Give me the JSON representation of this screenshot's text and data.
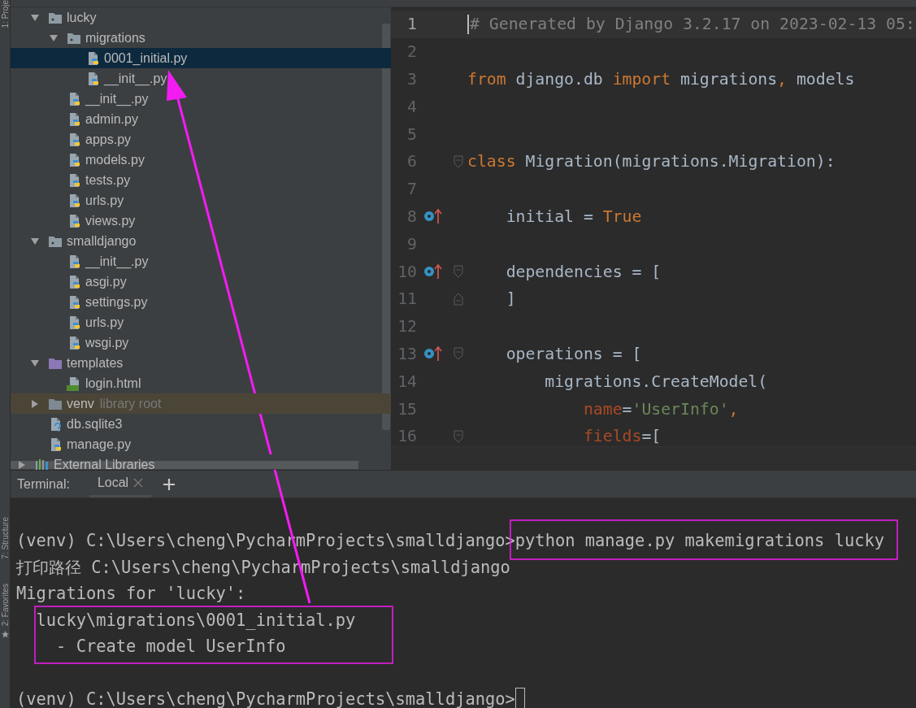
{
  "tool_strip": [
    "1: Proje",
    "7: Structure",
    "2: Favorites"
  ],
  "tree": [
    {
      "label": "lucky",
      "kind": "package",
      "expanded": true,
      "selected": false,
      "children": [
        {
          "label": "migrations",
          "kind": "package",
          "expanded": true,
          "selected": false,
          "children": [
            {
              "label": "0001_initial.py",
              "kind": "python",
              "selected": true
            },
            {
              "label": "__init__.py",
              "kind": "python",
              "selected": false
            }
          ]
        },
        {
          "label": "__init__.py",
          "kind": "python",
          "selected": false
        },
        {
          "label": "admin.py",
          "kind": "python",
          "selected": false
        },
        {
          "label": "apps.py",
          "kind": "python",
          "selected": false
        },
        {
          "label": "models.py",
          "kind": "python",
          "selected": false
        },
        {
          "label": "tests.py",
          "kind": "python",
          "selected": false
        },
        {
          "label": "urls.py",
          "kind": "python",
          "selected": false
        },
        {
          "label": "views.py",
          "kind": "python",
          "selected": false
        }
      ]
    },
    {
      "label": "smalldjango",
      "kind": "package",
      "expanded": true,
      "selected": false,
      "children": [
        {
          "label": "__init__.py",
          "kind": "python",
          "selected": false
        },
        {
          "label": "asgi.py",
          "kind": "python",
          "selected": false
        },
        {
          "label": "settings.py",
          "kind": "python",
          "selected": false
        },
        {
          "label": "urls.py",
          "kind": "python",
          "selected": false
        },
        {
          "label": "wsgi.py",
          "kind": "python",
          "selected": false
        }
      ]
    },
    {
      "label": "templates",
      "kind": "templates-folder",
      "expanded": true,
      "selected": false,
      "children": [
        {
          "label": "login.html",
          "kind": "html",
          "selected": false
        }
      ]
    },
    {
      "label": "venv",
      "kind": "excluded-folder",
      "expanded": false,
      "selected": false,
      "hint": "library root"
    },
    {
      "label": "db.sqlite3",
      "kind": "unknown",
      "selected": false
    },
    {
      "label": "manage.py",
      "kind": "python",
      "selected": false
    },
    {
      "label": "External Libraries",
      "kind": "libraries",
      "expanded": false,
      "selected": false
    }
  ],
  "editor": {
    "lines": [
      {
        "number": "1",
        "current": true,
        "tokens": [
          {
            "text": "# Generated by Django 3.2.17 on 2023-02-13 05:",
            "kind": "comment"
          }
        ]
      },
      {
        "number": "2",
        "current": false
      },
      {
        "number": "3",
        "current": false,
        "tokens": [
          {
            "text": "from ",
            "kind": "keyword"
          },
          {
            "text": "django.db ",
            "kind": "plain"
          },
          {
            "text": "import ",
            "kind": "keyword"
          },
          {
            "text": "migrations",
            "kind": "plain"
          },
          {
            "text": ", ",
            "kind": "keyword"
          },
          {
            "text": "models",
            "kind": "plain"
          }
        ]
      },
      {
        "number": "4",
        "current": false
      },
      {
        "number": "5",
        "current": false
      },
      {
        "number": "6",
        "current": false,
        "fold_start": true,
        "tokens": [
          {
            "text": "class ",
            "kind": "keyword"
          },
          {
            "text": "Migration(migrations.Migration):",
            "kind": "plain"
          }
        ]
      },
      {
        "number": "7",
        "current": false
      },
      {
        "number": "8",
        "current": false,
        "override": true,
        "tokens": [
          {
            "text": "    initial = ",
            "kind": "plain"
          },
          {
            "text": "True",
            "kind": "keyword"
          }
        ]
      },
      {
        "number": "9",
        "current": false
      },
      {
        "number": "10",
        "current": false,
        "override": true,
        "fold_start": true,
        "tokens": [
          {
            "text": "    dependencies = [",
            "kind": "plain"
          }
        ]
      },
      {
        "number": "11",
        "current": false,
        "fold_end": true,
        "tokens": [
          {
            "text": "    ]",
            "kind": "plain"
          }
        ]
      },
      {
        "number": "12",
        "current": false
      },
      {
        "number": "13",
        "current": false,
        "override": true,
        "fold_start": true,
        "tokens": [
          {
            "text": "    operations = [",
            "kind": "plain"
          }
        ]
      },
      {
        "number": "14",
        "current": false,
        "tokens": [
          {
            "text": "        migrations.CreateModel(",
            "kind": "plain"
          }
        ]
      },
      {
        "number": "15",
        "current": false,
        "tokens": [
          {
            "text": "            name",
            "kind": "param"
          },
          {
            "text": "=",
            "kind": "plain"
          },
          {
            "text": "'UserInfo'",
            "kind": "string"
          },
          {
            "text": ",",
            "kind": "keyword"
          }
        ]
      },
      {
        "number": "16",
        "current": false,
        "fold_start": true,
        "tokens": [
          {
            "text": "            fields",
            "kind": "param"
          },
          {
            "text": "=[",
            "kind": "plain"
          }
        ]
      }
    ]
  },
  "terminal": {
    "title": "Terminal:",
    "tabs": [
      {
        "label": "Local",
        "selected": true
      }
    ],
    "lines": [
      {
        "kind": "output",
        "text": "(venv) C:\\Users\\cheng\\PycharmProjects\\smalldjango>python manage.py makemigrations lucky"
      },
      {
        "kind": "output",
        "text": "打印路径 C:\\Users\\cheng\\PycharmProjects\\smalldjango"
      },
      {
        "kind": "output",
        "text": "Migrations for 'lucky':"
      },
      {
        "kind": "output",
        "text": "  lucky\\migrations\\0001_initial.py"
      },
      {
        "kind": "output",
        "text": "    - Create model UserInfo"
      },
      {
        "kind": "prompt",
        "text": "(venv) C:\\Users\\cheng\\PycharmProjects\\smalldjango>"
      }
    ]
  },
  "annotations": [
    {
      "kind": "arrow"
    },
    {
      "kind": "box"
    },
    {
      "kind": "box"
    }
  ]
}
